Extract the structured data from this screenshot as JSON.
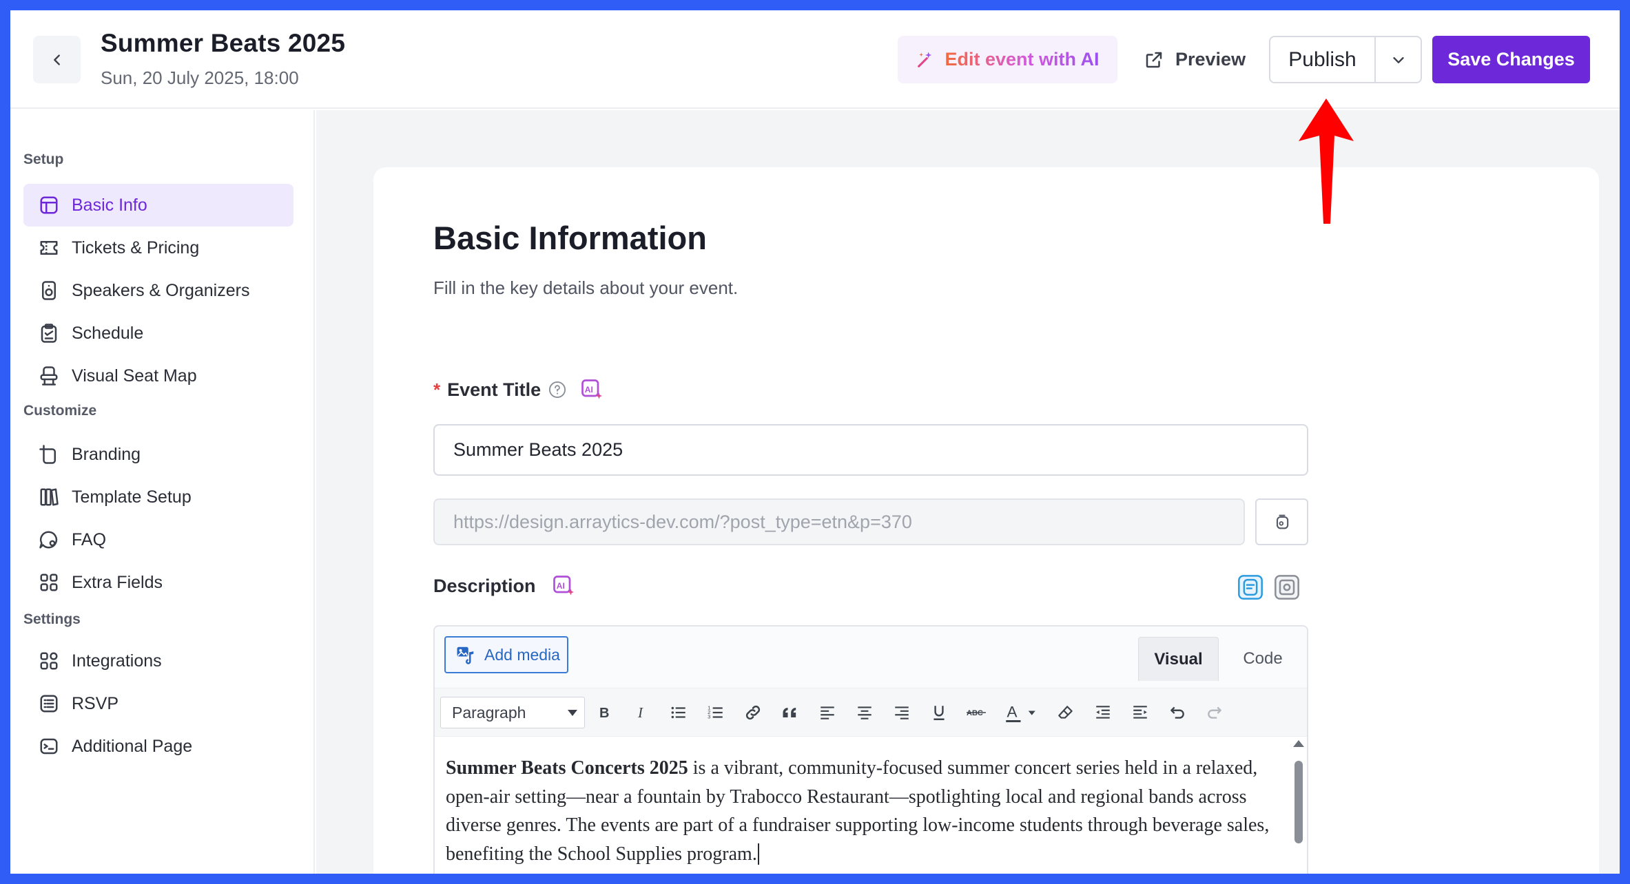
{
  "header": {
    "title": "Summer Beats 2025",
    "date": "Sun, 20 July 2025, 18:00",
    "ai_label": "Edit event with AI",
    "preview_label": "Preview",
    "publish_label": "Publish",
    "save_label": "Save Changes"
  },
  "sidebar": {
    "sections": [
      {
        "label": "Setup"
      },
      {
        "label": "Customize"
      },
      {
        "label": "Settings"
      }
    ],
    "items": [
      {
        "label": "Basic Info",
        "icon": "layout-icon",
        "active": true
      },
      {
        "label": "Tickets & Pricing",
        "icon": "ticket-icon"
      },
      {
        "label": "Speakers & Organizers",
        "icon": "speaker-icon"
      },
      {
        "label": "Schedule",
        "icon": "clipboard-icon"
      },
      {
        "label": "Visual Seat Map",
        "icon": "seat-icon"
      },
      {
        "label": "Branding",
        "icon": "crop-icon"
      },
      {
        "label": "Template Setup",
        "icon": "book-icon"
      },
      {
        "label": "FAQ",
        "icon": "chat-icon"
      },
      {
        "label": "Extra Fields",
        "icon": "grid-icon"
      },
      {
        "label": "Integrations",
        "icon": "apps-icon"
      },
      {
        "label": "RSVP",
        "icon": "list-icon"
      },
      {
        "label": "Additional Page",
        "icon": "page-icon"
      }
    ]
  },
  "main": {
    "title": "Basic Information",
    "subtitle": "Fill in the key details about your event.",
    "event_title_label": "Event Title",
    "event_title_value": "Summer Beats 2025",
    "url_value": "https://design.arraytics-dev.com/?post_type=etn&p=370",
    "description_label": "Description",
    "editor": {
      "add_media_label": "Add media",
      "tab_visual": "Visual",
      "tab_code": "Code",
      "format_value": "Paragraph",
      "content_bold": "Summer Beats Concerts 2025",
      "content_rest": " is a vibrant, community-focused summer concert series held in a relaxed, open-air setting—near a fountain by Trabocco Restaurant—spotlighting local and regional bands across diverse genres. The events are part of a fundraiser supporting low-income students through beverage sales, benefiting the School Supplies program."
    }
  },
  "colors": {
    "accent": "#6d28d9",
    "accent_light": "#efe9fd",
    "frame": "#2f5df5",
    "annotation": "#ff0000"
  }
}
